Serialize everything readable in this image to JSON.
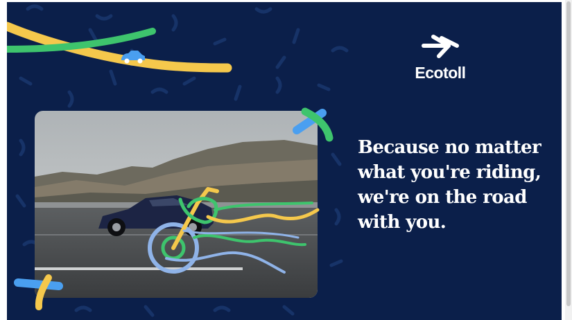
{
  "brand": {
    "name": "Ecotoll",
    "logo_icon": "double-arrow-logo-icon"
  },
  "headline": {
    "lines": [
      "Because no matter",
      "what you're riding,",
      "we're on the road",
      "with you."
    ]
  },
  "colors": {
    "background": "#0b1f4a",
    "pattern": "#173368",
    "yellow": "#f5c84c",
    "green": "#3ec46d",
    "blue": "#4a9ff0",
    "text": "#ffffff"
  },
  "illustrations": {
    "car_icon": "small-blue-car-icon",
    "photo": "sports-car-on-highway-photo",
    "bike_doodle": "motorcycle-doodle-icon"
  }
}
